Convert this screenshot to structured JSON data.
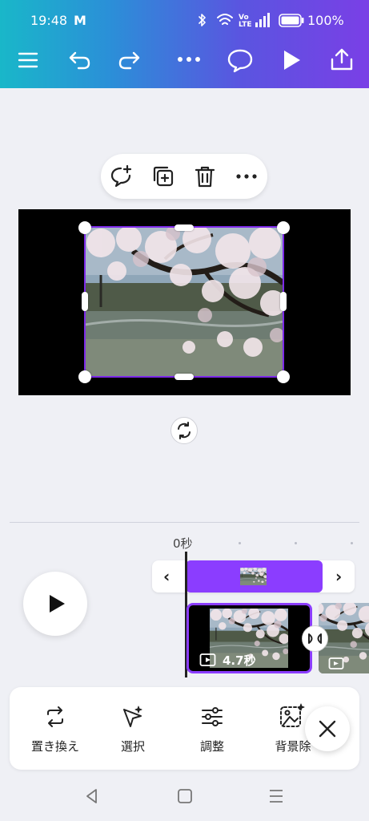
{
  "status_bar": {
    "time": "19:48",
    "mail_icon": "M",
    "battery": "100%"
  },
  "top_toolbar": {
    "menu_icon": "menu-icon",
    "undo_icon": "undo-icon",
    "redo_icon": "redo-icon",
    "more_icon": "more-icon",
    "comment_icon": "comment-icon",
    "play_icon": "play-icon",
    "share_icon": "share-icon"
  },
  "context_toolbar": {
    "items": [
      "add-comment-icon",
      "duplicate-icon",
      "delete-icon",
      "more-icon"
    ]
  },
  "timeline": {
    "time_marker": "0秒",
    "clip_duration": "4.7秒"
  },
  "bottom_tools": {
    "items": [
      {
        "label": "置き換え",
        "icon": "replace-icon"
      },
      {
        "label": "選択",
        "icon": "select-icon"
      },
      {
        "label": "調整",
        "icon": "adjust-icon"
      },
      {
        "label": "背景除",
        "icon": "bg-remove-icon"
      }
    ]
  },
  "colors": {
    "accent": "#8b3dff",
    "selection": "#7d2ae8",
    "header_start": "#19b7c9",
    "header_end": "#7a3fe6"
  }
}
